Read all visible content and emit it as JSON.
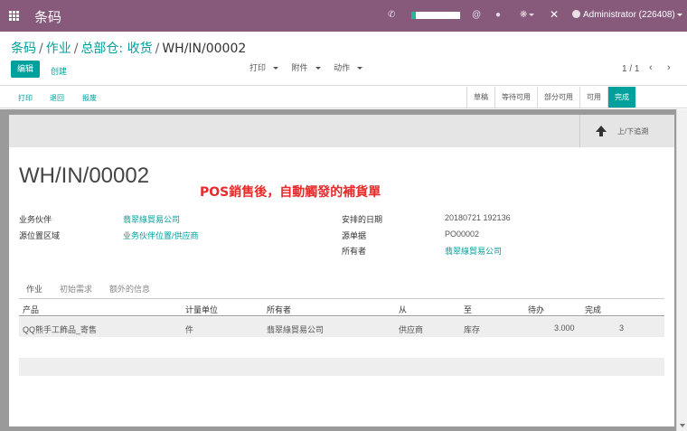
{
  "topbar": {
    "app_title": "条码",
    "user": "Administrator (226408)",
    "icons": [
      "apps-grid-icon",
      "phone-icon",
      "at-icon",
      "chat-icon",
      "bug-icon",
      "close-icon"
    ]
  },
  "breadcrumb": {
    "items": [
      "条码",
      "作业",
      "总部仓: 收货"
    ],
    "current": "WH/IN/00002"
  },
  "control": {
    "edit_label": "编辑",
    "create_label": "创建",
    "print_menu": "打印",
    "attachment_menu": "附件",
    "action_menu": "动作",
    "pager": "1 / 1"
  },
  "statusbar": {
    "buttons": [
      "打印",
      "退回",
      "报废"
    ],
    "stages": [
      "草稿",
      "等待可用",
      "部分可用",
      "可用",
      "完成"
    ],
    "active_stage": "完成"
  },
  "sheet": {
    "upstream_label": "上/下追溯",
    "reference": "WH/IN/00002",
    "annotation": "POS銷售後，自動觸發的補貨單",
    "partner_label": "业务伙伴",
    "partner_value": "翡翠綠貿易公司",
    "source_location_label": "源位置区域",
    "source_location_value": "业务伙伴位置/供应商",
    "scheduled_date_label": "安排的日期",
    "scheduled_date_value": "20180721 192136",
    "origin_label": "源单据",
    "origin_value": "PO00002",
    "owner_label": "所有者",
    "owner_value": "翡翠綠貿易公司"
  },
  "tabs": [
    "作业",
    "初始需求",
    "额外的信息"
  ],
  "table": {
    "headers": [
      "产品",
      "计量单位",
      "所有者",
      "从",
      "至",
      "待办",
      "完成"
    ],
    "rows": [
      [
        "QQ熊手工飾品_寄售",
        "件",
        "翡翠綠貿易公司",
        "供应商",
        "库存",
        "3.000",
        "3"
      ]
    ]
  },
  "colors": {
    "brand": "#875a7b",
    "accent": "#00a09d",
    "annotation": "#e52b2b"
  }
}
